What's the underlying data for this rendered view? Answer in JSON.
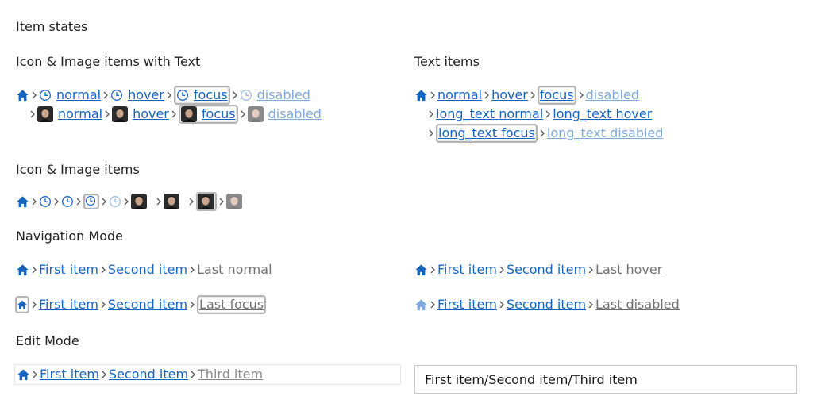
{
  "sections": {
    "item_states": "Item states",
    "icon_image_text": "Icon & Image items with Text",
    "text_items": "Text items",
    "icon_image": "Icon & Image items",
    "navigation_mode": "Navigation Mode",
    "edit_mode": "Edit Mode"
  },
  "icon_text": {
    "row1": {
      "normal": "normal",
      "hover": "hover",
      "focus": "focus",
      "disabled": "disabled"
    },
    "row2": {
      "normal": "normal",
      "hover": "hover",
      "focus": "focus",
      "disabled": "disabled"
    }
  },
  "text_items": {
    "normal": "normal",
    "hover": "hover",
    "focus": "focus",
    "disabled": "disabled",
    "long_normal": "long_text normal",
    "long_hover": "long_text hover",
    "long_focus": "long_text focus",
    "long_disabled": "long_text disabled"
  },
  "nav": {
    "first": "First item",
    "second": "Second item",
    "last_normal": "Last normal",
    "last_hover": "Last hover",
    "last_focus": "Last focus",
    "last_disabled": "Last disabled"
  },
  "edit": {
    "first": "First item",
    "second": "Second item",
    "third": "Third item",
    "path_value": "First item/Second item/Third item"
  },
  "icons": {
    "home": "home-icon",
    "separator": "chevron-right-icon",
    "clock": "clock-icon",
    "photo": "avatar-photo-icon"
  },
  "colors": {
    "link": "#1565c0",
    "link_disabled": "#7fa8dc",
    "home": "#1565c0",
    "current": "#707070",
    "focus_border": "#b4b4b4"
  }
}
